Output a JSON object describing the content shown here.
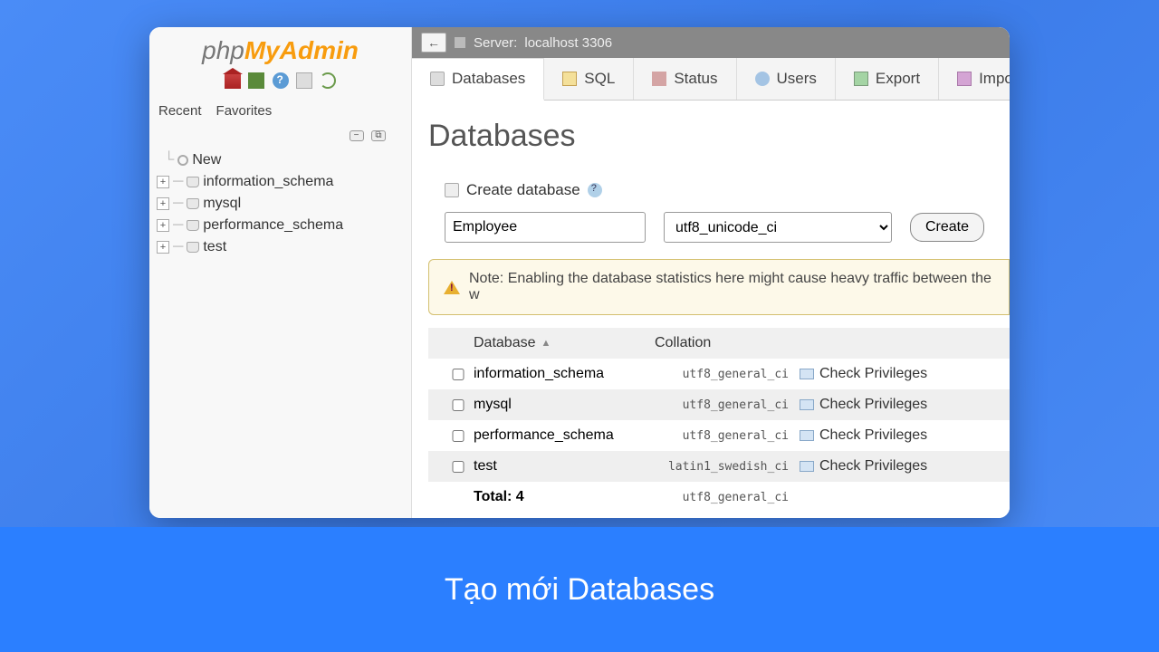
{
  "logo": {
    "part1": "php",
    "part2": "My",
    "part3": "Admin"
  },
  "sidebar_tabs": {
    "recent": "Recent",
    "favorites": "Favorites"
  },
  "tree": {
    "new_label": "New",
    "items": [
      {
        "label": "information_schema"
      },
      {
        "label": "mysql"
      },
      {
        "label": "performance_schema"
      },
      {
        "label": "test"
      }
    ]
  },
  "server_bar": {
    "back": "←",
    "server_label": "Server:",
    "server_value": "localhost 3306"
  },
  "main_tabs": [
    {
      "label": "Databases",
      "icon": "tic-db",
      "active": true
    },
    {
      "label": "SQL",
      "icon": "tic-sql",
      "active": false
    },
    {
      "label": "Status",
      "icon": "tic-status",
      "active": false
    },
    {
      "label": "Users",
      "icon": "tic-users",
      "active": false
    },
    {
      "label": "Export",
      "icon": "tic-export",
      "active": false
    },
    {
      "label": "Import",
      "icon": "tic-import",
      "active": false
    }
  ],
  "page_title": "Databases",
  "create": {
    "label": "Create database",
    "input_value": "Employee",
    "collation": "utf8_unicode_ci",
    "button": "Create"
  },
  "note": "Note: Enabling the database statistics here might cause heavy traffic between the w",
  "table": {
    "head": {
      "database": "Database",
      "collation": "Collation"
    },
    "rows": [
      {
        "name": "information_schema",
        "collation": "utf8_general_ci",
        "action": "Check Privileges",
        "alt": false
      },
      {
        "name": "mysql",
        "collation": "utf8_general_ci",
        "action": "Check Privileges",
        "alt": true
      },
      {
        "name": "performance_schema",
        "collation": "utf8_general_ci",
        "action": "Check Privileges",
        "alt": false
      },
      {
        "name": "test",
        "collation": "latin1_swedish_ci",
        "action": "Check Privileges",
        "alt": true
      }
    ],
    "foot": {
      "total": "Total: 4",
      "collation": "utf8_general_ci"
    }
  },
  "caption": "Tạo mới Databases"
}
